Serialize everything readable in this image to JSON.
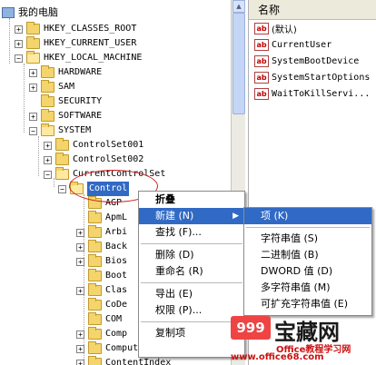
{
  "tree": {
    "root_label": "我的电脑",
    "items": [
      {
        "label": "HKEY_CLASSES_ROOT",
        "expander": "+"
      },
      {
        "label": "HKEY_CURRENT_USER",
        "expander": "+"
      },
      {
        "label": "HKEY_LOCAL_MACHINE",
        "expander": "−"
      },
      {
        "label": "HARDWARE",
        "expander": "+"
      },
      {
        "label": "SAM",
        "expander": "+"
      },
      {
        "label": "SECURITY",
        "expander": ""
      },
      {
        "label": "SOFTWARE",
        "expander": "+"
      },
      {
        "label": "SYSTEM",
        "expander": "−"
      },
      {
        "label": "ControlSet001",
        "expander": "+"
      },
      {
        "label": "ControlSet002",
        "expander": "+"
      },
      {
        "label": "CurrentControlSet",
        "expander": "−"
      },
      {
        "label": "Control",
        "expander": "−"
      },
      {
        "label": "AGP",
        "expander": ""
      },
      {
        "label": "ApmL",
        "expander": ""
      },
      {
        "label": "Arbi",
        "expander": "+"
      },
      {
        "label": "Back",
        "expander": "+"
      },
      {
        "label": "Bios",
        "expander": "+"
      },
      {
        "label": "Boot",
        "expander": ""
      },
      {
        "label": "Clas",
        "expander": "+"
      },
      {
        "label": "CoDe",
        "expander": ""
      },
      {
        "label": "COM",
        "expander": ""
      },
      {
        "label": "Comp",
        "expander": "+"
      },
      {
        "label": "ComputerName",
        "expander": "+"
      },
      {
        "label": "ContentIndex",
        "expander": "+"
      }
    ]
  },
  "list": {
    "header": "名称",
    "items": [
      {
        "icon": "ab",
        "label": "(默认)"
      },
      {
        "icon": "ab",
        "label": "CurrentUser"
      },
      {
        "icon": "ab",
        "label": "SystemBootDevice"
      },
      {
        "icon": "ab",
        "label": "SystemStartOptions"
      },
      {
        "icon": "ab",
        "label": "WaitToKillServi..."
      }
    ]
  },
  "context_menu": {
    "items": [
      {
        "label": "折叠"
      },
      {
        "label": "新建 (N)"
      },
      {
        "label": "查找 (F)..."
      },
      {
        "label": "删除 (D)"
      },
      {
        "label": "重命名 (R)"
      },
      {
        "label": "导出 (E)"
      },
      {
        "label": "权限 (P)..."
      },
      {
        "label": "复制项"
      }
    ]
  },
  "submenu": {
    "items": [
      {
        "label": "项 (K)"
      },
      {
        "label": "字符串值 (S)"
      },
      {
        "label": "二进制值 (B)"
      },
      {
        "label": "DWORD 值 (D)"
      },
      {
        "label": "多字符串值 (M)"
      },
      {
        "label": "可扩充字符串值 (E)"
      }
    ]
  },
  "watermark": {
    "badge": "999",
    "title": "宝藏网",
    "subtitle": "Office教程学习网",
    "url": "www.office68.com"
  },
  "colors": {
    "selection": "#316ac5",
    "circle": "#cc2020",
    "folder": "#f4d46c"
  }
}
